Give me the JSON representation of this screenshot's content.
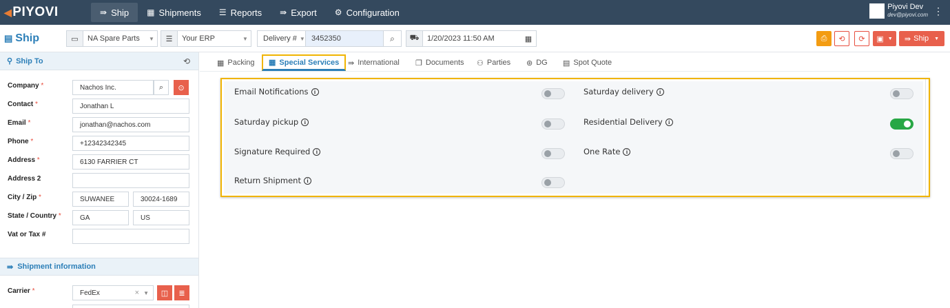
{
  "topnav": {
    "logo": "PIYOVI",
    "items": [
      {
        "label": "Ship",
        "icon": "ship-icon",
        "active": true
      },
      {
        "label": "Shipments",
        "icon": "shipments-icon"
      },
      {
        "label": "Reports",
        "icon": "reports-icon"
      },
      {
        "label": "Export",
        "icon": "export-icon"
      },
      {
        "label": "Configuration",
        "icon": "gear-icon"
      }
    ],
    "user": {
      "name": "Piyovi Dev",
      "email": "dev@piyovi.com"
    }
  },
  "toolbar": {
    "title": "Ship",
    "location": "NA Spare Parts",
    "source": "Your ERP",
    "ref_type": "Delivery #",
    "ref_value": "3452350",
    "datetime": "1/20/2023 11:50 AM"
  },
  "ship_to": {
    "header": "Ship To",
    "fields": [
      {
        "label": "Company",
        "required": "*",
        "value": "Nachos Inc."
      },
      {
        "label": "Contact",
        "required": "*",
        "value": "Jonathan L"
      },
      {
        "label": "Email",
        "required": "*",
        "value": "jonathan@nachos.com"
      },
      {
        "label": "Phone",
        "required": "*",
        "value": "+12342342345"
      },
      {
        "label": "Address",
        "required": "*",
        "value": "6130 FARRIER CT"
      },
      {
        "label": "Address 2",
        "required": "",
        "value": ""
      },
      {
        "label": "City / Zip",
        "required": "*",
        "value": "SUWANEE",
        "value2": "30024-1689"
      },
      {
        "label": "State / Country",
        "required": "*",
        "value": "GA",
        "value2": "US"
      },
      {
        "label": "Vat or Tax #",
        "required": "",
        "value": ""
      }
    ]
  },
  "shipment_info": {
    "header": "Shipment information",
    "carrier_label": "Carrier",
    "carrier_required": "*",
    "carrier_value": "FedEx",
    "clear_glyph": "×"
  },
  "tabs": [
    {
      "label": "Packing",
      "icon": "packing-icon"
    },
    {
      "label": "Special Services",
      "icon": "special-services-icon",
      "active": true
    },
    {
      "label": "International",
      "icon": "international-icon"
    },
    {
      "label": "Documents",
      "icon": "documents-icon"
    },
    {
      "label": "Parties",
      "icon": "parties-icon"
    },
    {
      "label": "DG",
      "icon": "dg-icon"
    },
    {
      "label": "Spot Quote",
      "icon": "spot-quote-icon"
    }
  ],
  "special_services": {
    "left": [
      {
        "label": "Email Notifications",
        "on": false
      },
      {
        "label": "Saturday pickup",
        "on": false
      },
      {
        "label": "Signature Required",
        "on": false
      },
      {
        "label": "Return Shipment",
        "on": false
      }
    ],
    "right": [
      {
        "label": "Saturday delivery",
        "on": false
      },
      {
        "label": "Residential Delivery",
        "on": true
      },
      {
        "label": "One Rate",
        "on": false
      }
    ]
  },
  "colors": {
    "accent": "#2c7fb8",
    "nav": "#34495e",
    "highlight": "#f0b400",
    "danger": "#e8604c",
    "success": "#28a745"
  }
}
